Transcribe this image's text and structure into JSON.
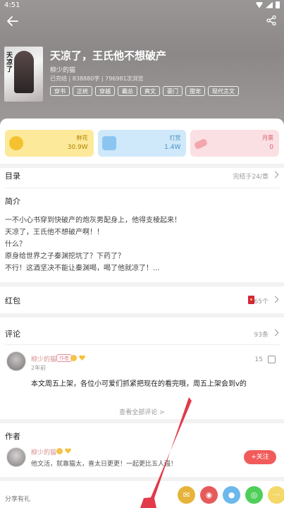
{
  "status_bar": {
    "time": "4:51"
  },
  "book": {
    "title": "天凉了，王氏他不想破产",
    "cover_text": "天凉了",
    "author": "柳少的猫",
    "stats": "已完结 | 838880字 | 796981次浏览",
    "tags": [
      "穿书",
      "正统",
      "穿越",
      "霸总",
      "爽文",
      "豪门",
      "甜宠",
      "现代言文"
    ]
  },
  "stats": [
    {
      "label": "鲜花",
      "value": "30.9W"
    },
    {
      "label": "打赏",
      "value": "1.4W"
    },
    {
      "label": "月票",
      "value": "0"
    }
  ],
  "catalog": {
    "title": "目录",
    "info": "完结于24/章"
  },
  "intro": {
    "title": "简介",
    "lines": [
      "一不小心书穿到快破产的炮灰男配身上，他得支棱起来！",
      "天凉了，王氏他不想破产啊！！",
      "什么？",
      "原身给世界之子秦渊挖坑了？下药了？",
      "不行！这酒坚决不能让秦渊喝，喝了他就凉了！..."
    ]
  },
  "redpacket": {
    "title": "红包",
    "count": "65个"
  },
  "comments": {
    "title": "评论",
    "count": "93条",
    "item": {
      "user": "柳少的猫",
      "badge": "作者",
      "time": "2年前",
      "likes": "15",
      "text": "本文周五上架，各位小可爱们抓紧把现在的看完哦，周五上架会到v的"
    },
    "more": "查看全部评论 >"
  },
  "author_section": {
    "title": "作者",
    "name": "柳少的猫",
    "desc": "他文活，就靠猫太，喜太日更更！一起更比五人强！",
    "follow": "+关注"
  },
  "share": {
    "label": "分享有礼",
    "icons": [
      "mail-icon",
      "weibo-icon",
      "qq-icon",
      "wechat-icon",
      "more-icon"
    ]
  }
}
